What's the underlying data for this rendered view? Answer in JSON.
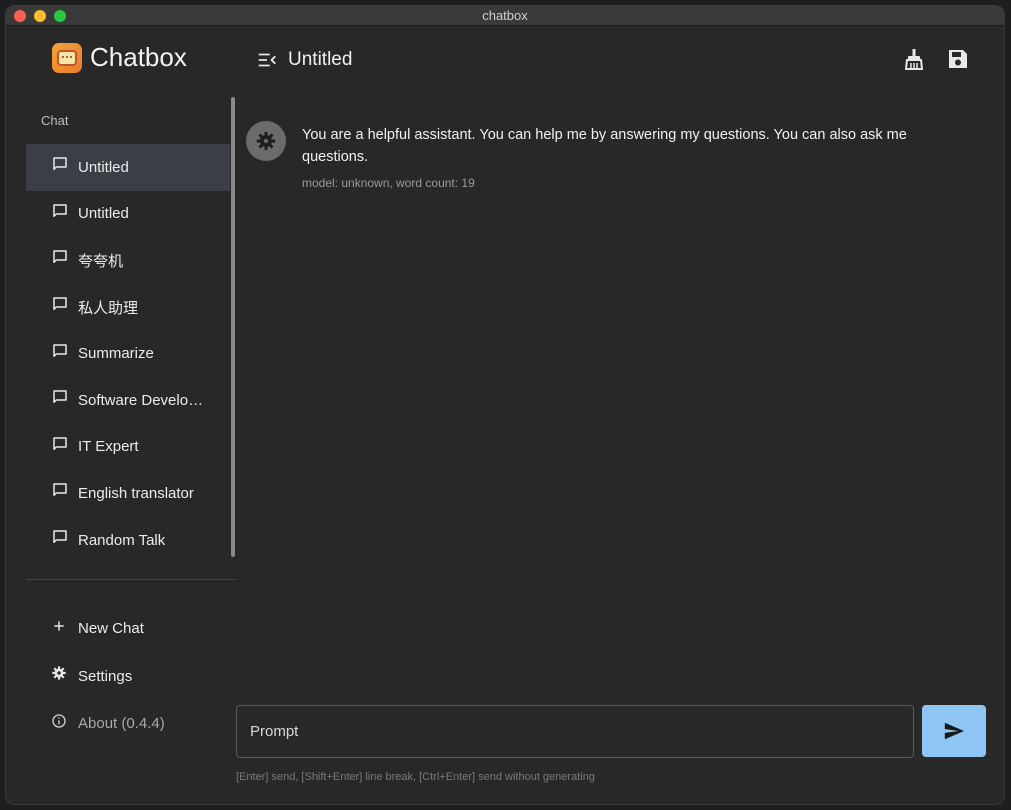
{
  "window": {
    "title": "chatbox"
  },
  "sidebar": {
    "brand": "Chatbox",
    "section_label": "Chat",
    "chats": [
      {
        "label": "Untitled",
        "active": true
      },
      {
        "label": "Untitled",
        "active": false
      },
      {
        "label": "夸夸机",
        "active": false
      },
      {
        "label": "私人助理",
        "active": false
      },
      {
        "label": "Summarize",
        "active": false
      },
      {
        "label": "Software Developer",
        "active": false
      },
      {
        "label": "IT Expert",
        "active": false
      },
      {
        "label": "English translator",
        "active": false
      },
      {
        "label": "Random Talk",
        "active": false
      }
    ],
    "nav": {
      "new_chat": "New Chat",
      "settings": "Settings",
      "about": "About (0.4.4)"
    }
  },
  "header": {
    "title": "Untitled"
  },
  "messages": [
    {
      "role": "system",
      "text": "You are a helpful assistant. You can help me by answering my questions. You can also ask me questions.",
      "meta": "model: unknown, word count: 19"
    }
  ],
  "composer": {
    "placeholder": "Prompt",
    "hint": "[Enter] send, [Shift+Enter] line break, [Ctrl+Enter] send without generating"
  },
  "colors": {
    "active_item": "#3a3f45",
    "send_button": "#8fc6f5",
    "background": "#282828"
  }
}
